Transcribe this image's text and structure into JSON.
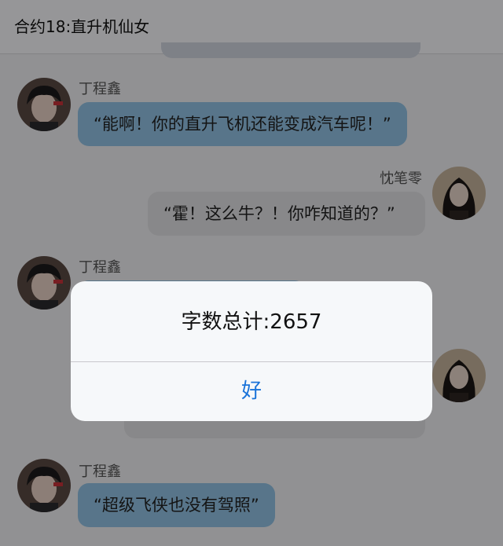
{
  "header": {
    "title": "合约18:直升机仙女"
  },
  "messages": [
    {
      "sender": "丁程鑫",
      "side": "left",
      "text": "“能啊！你的直升飞机还能变成汽车呢！”"
    },
    {
      "sender": "忱笔零",
      "side": "right",
      "text": "“霍！这么牛？！你咋知道的？”"
    },
    {
      "sender": "丁程鑫",
      "side": "left",
      "text": ""
    },
    {
      "sender": "",
      "side": "right",
      "text": ""
    },
    {
      "sender": "丁程鑫",
      "side": "left",
      "text": "“超级飞侠也没有驾照”"
    }
  ],
  "alert": {
    "message": "字数总计:2657",
    "button": "好"
  },
  "colors": {
    "bubble_left": "#93c4e6",
    "bubble_right": "#e3e3e6",
    "alert_button": "#1a73d9"
  },
  "icons": {
    "left_avatar": "boy-avatar-icon",
    "right_avatar": "girl-avatar-icon"
  }
}
